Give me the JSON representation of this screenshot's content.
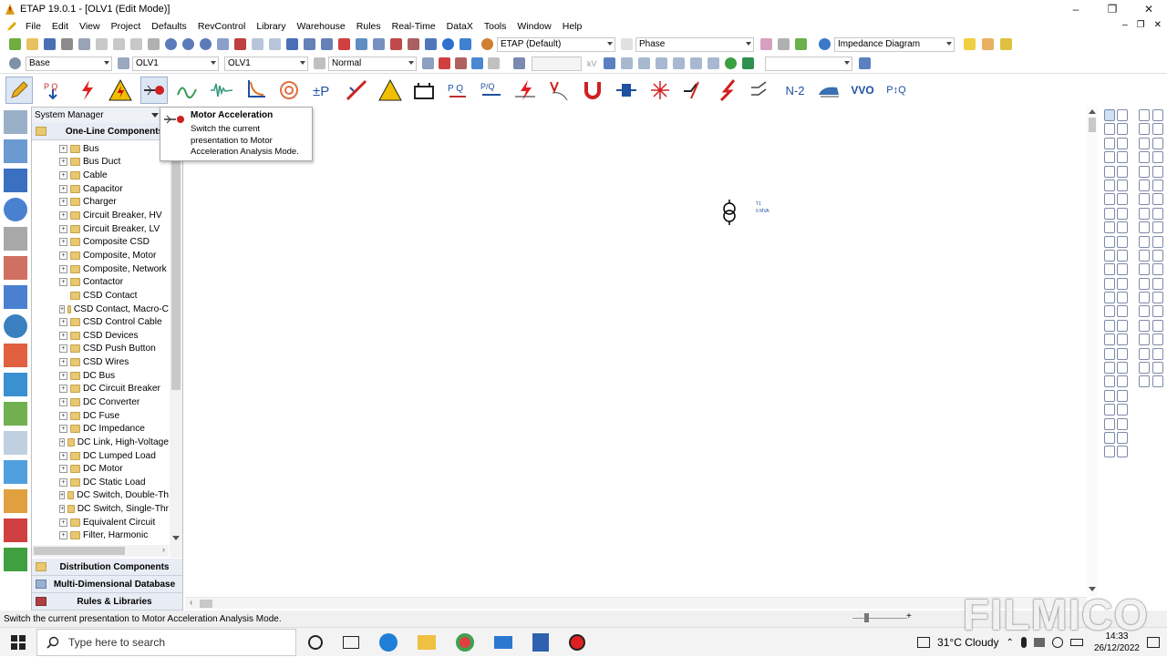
{
  "window": {
    "title": "ETAP 19.0.1 - [OLV1 (Edit Mode)]"
  },
  "menu": [
    "File",
    "Edit",
    "View",
    "Project",
    "Defaults",
    "RevControl",
    "Library",
    "Warehouse",
    "Rules",
    "Real-Time",
    "DataX",
    "Tools",
    "Window",
    "Help"
  ],
  "toolbar1": {
    "preset": "ETAP (Default)",
    "phase": "Phase",
    "diagram": "Impedance Diagram"
  },
  "toolbar2": {
    "config": "Base",
    "presentation": "OLV1",
    "revision": "OLV1",
    "mode": "Normal",
    "unit_kv": "kV"
  },
  "toolbar3_extra_labels": {
    "n2": "N-2",
    "vvo": "VVO",
    "pvq": "P↕Q"
  },
  "tooltip": {
    "title": "Motor Acceleration",
    "body": "Switch the current presentation to Motor Acceleration Analysis Mode."
  },
  "system_manager": {
    "header": "System Manager",
    "top_section": "One-Line Components",
    "tree": [
      "Bus",
      "Bus Duct",
      "Cable",
      "Capacitor",
      "Charger",
      "Circuit Breaker, HV",
      "Circuit Breaker, LV",
      "Composite CSD",
      "Composite, Motor",
      "Composite, Network",
      "Contactor",
      "CSD Contact",
      "CSD Contact, Macro-C",
      "CSD Control Cable",
      "CSD Devices",
      "CSD Push Button",
      "CSD Wires",
      "DC Bus",
      "DC Circuit Breaker",
      "DC Converter",
      "DC Fuse",
      "DC Impedance",
      "DC Link, High-Voltage",
      "DC Lumped Load",
      "DC Motor",
      "DC Static Load",
      "DC Switch, Double-Th",
      "DC Switch, Single-Thr",
      "Equivalent Circuit",
      "Filter, Harmonic"
    ],
    "bottom_sections": [
      "Distribution Components",
      "Multi-Dimensional Database",
      "Rules & Libraries"
    ]
  },
  "canvas": {
    "transformer_label": "T1",
    "transformer_rating": "0 MVA"
  },
  "status": {
    "message": "Switch the current presentation to Motor Acceleration Analysis Mode."
  },
  "taskbar": {
    "search_placeholder": "Type here to search",
    "weather": "31°C  Cloudy",
    "time": "14:33",
    "date": "26/12/2022"
  },
  "watermark": "FILMICO",
  "colors": {
    "accent": "#0078d7",
    "tooltip_border": "#a8a8a8",
    "section_bg": "#e8ecf4"
  }
}
